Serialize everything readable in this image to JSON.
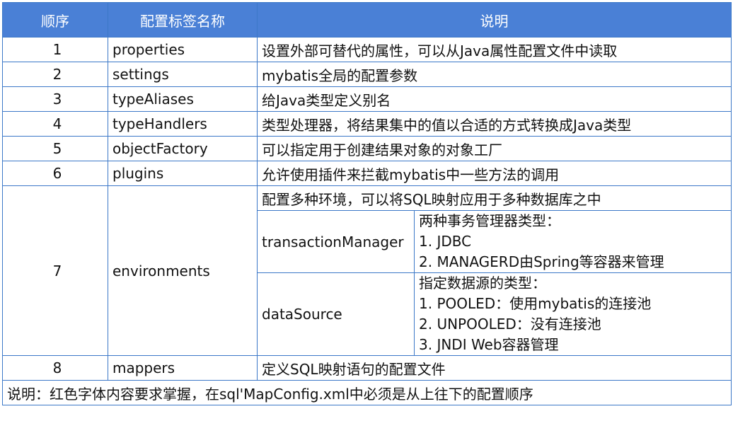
{
  "header": {
    "col_order": "顺序",
    "col_name": "配置标签名称",
    "col_desc": "说明"
  },
  "rows": [
    {
      "seq": "1",
      "name": "properties",
      "desc": "设置外部可替代的属性，可以从Java属性配置文件中读取",
      "important": true
    },
    {
      "seq": "2",
      "name": "settings",
      "desc": "mybatis全局的配置参数",
      "important": false
    },
    {
      "seq": "3",
      "name": "typeAliases",
      "desc": "给Java类型定义别名",
      "important": true
    },
    {
      "seq": "4",
      "name": "typeHandlers",
      "desc": "类型处理器，将结果集中的值以合适的方式转换成Java类型",
      "important": false
    },
    {
      "seq": "5",
      "name": "objectFactory",
      "desc": "可以指定用于创建结果对象的对象工厂",
      "important": false
    },
    {
      "seq": "6",
      "name": "plugins",
      "desc": "允许使用插件来拦截mybatis中一些方法的调用",
      "important": false
    }
  ],
  "environments": {
    "seq": "7",
    "name": "environments",
    "desc": "配置多种环境，可以将SQL映射应用于多种数据库之中",
    "transaction_manager": {
      "name": "transactionManager",
      "lines": [
        "两种事务管理器类型：",
        "1. JDBC",
        "2. MANAGERD由Spring等容器来管理"
      ]
    },
    "data_source": {
      "name": "dataSource",
      "lines": [
        "指定数据源的类型：",
        "1. POOLED：使用mybatis的连接池",
        "2. UNPOOLED：没有连接池",
        "3. JNDI Web容器管理"
      ]
    }
  },
  "mappers": {
    "seq": "8",
    "name": "mappers",
    "desc": "定义SQL映射语句的配置文件"
  },
  "footer": {
    "note": "说明：红色字体内容要求掌握，在sql'MapConfig.xml中必须是从上往下的配置顺序"
  },
  "colors": {
    "header_bg": "#4a80d6",
    "border": "#3c78c8",
    "important_text": "#e5231b",
    "normal_text": "#111111"
  }
}
